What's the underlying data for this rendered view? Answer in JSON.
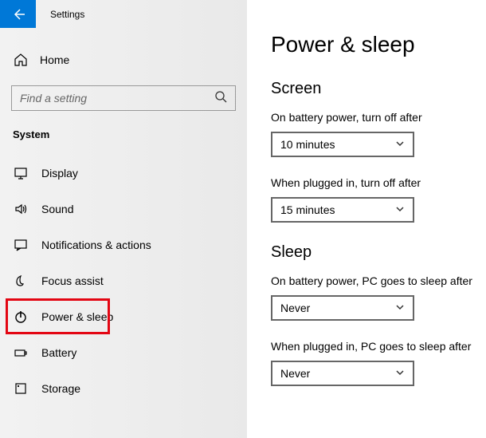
{
  "titlebar": {
    "label": "Settings"
  },
  "home": {
    "label": "Home"
  },
  "search": {
    "placeholder": "Find a setting"
  },
  "section": {
    "label": "System"
  },
  "nav": {
    "items": [
      {
        "label": "Display"
      },
      {
        "label": "Sound"
      },
      {
        "label": "Notifications & actions"
      },
      {
        "label": "Focus assist"
      },
      {
        "label": "Power & sleep"
      },
      {
        "label": "Battery"
      },
      {
        "label": "Storage"
      }
    ]
  },
  "page": {
    "title": "Power & sleep",
    "screen": {
      "heading": "Screen",
      "battery_label": "On battery power, turn off after",
      "battery_value": "10 minutes",
      "plugged_label": "When plugged in, turn off after",
      "plugged_value": "15 minutes"
    },
    "sleep": {
      "heading": "Sleep",
      "battery_label": "On battery power, PC goes to sleep after",
      "battery_value": "Never",
      "plugged_label": "When plugged in, PC goes to sleep after",
      "plugged_value": "Never"
    }
  }
}
